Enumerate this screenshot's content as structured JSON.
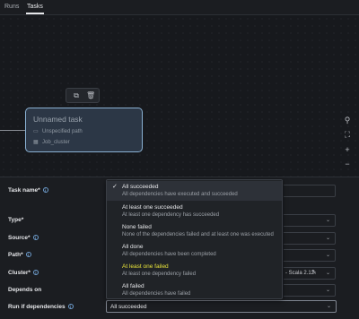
{
  "tabs": [
    {
      "label": "Runs",
      "active": false
    },
    {
      "label": "Tasks",
      "active": true
    }
  ],
  "node": {
    "title": "Unnamed task",
    "path": "Unspecified path",
    "cluster": "Job_cluster"
  },
  "toolbar_icons": [
    "copy-icon",
    "trash-icon"
  ],
  "zoom_controls": [
    "search-icon",
    "fit-view-icon",
    "zoom-in-icon",
    "zoom-out-icon"
  ],
  "form": {
    "task_name_label": "Task name*",
    "type_label": "Type*",
    "source_label": "Source*",
    "path_label": "Path*",
    "cluster_label": "Cluster*",
    "cluster_value_tail": "Scala 2.12",
    "depends_on_label": "Depends on",
    "run_if_label": "Run if dependencies",
    "run_if_value": "All succeeded"
  },
  "dropdown": {
    "options": [
      {
        "title": "All succeeded",
        "desc": "All dependencies have executed and succeeded",
        "selected": true
      },
      {
        "title": "At least one succeeded",
        "desc": "At least one dependency has succeeded"
      },
      {
        "title": "None failed",
        "desc": "None of the dependencies failed and at least one was executed"
      },
      {
        "title": "All done",
        "desc": "All dependencies have been completed"
      },
      {
        "title": "At least one failed",
        "desc": "At least one dependency failed",
        "highlight": true
      },
      {
        "title": "All failed",
        "desc": "All dependencies have failed"
      }
    ]
  },
  "colors": {
    "accent": "#8ab1d3",
    "highlight_text": "#e8e33a",
    "info": "#6f9fd0"
  }
}
